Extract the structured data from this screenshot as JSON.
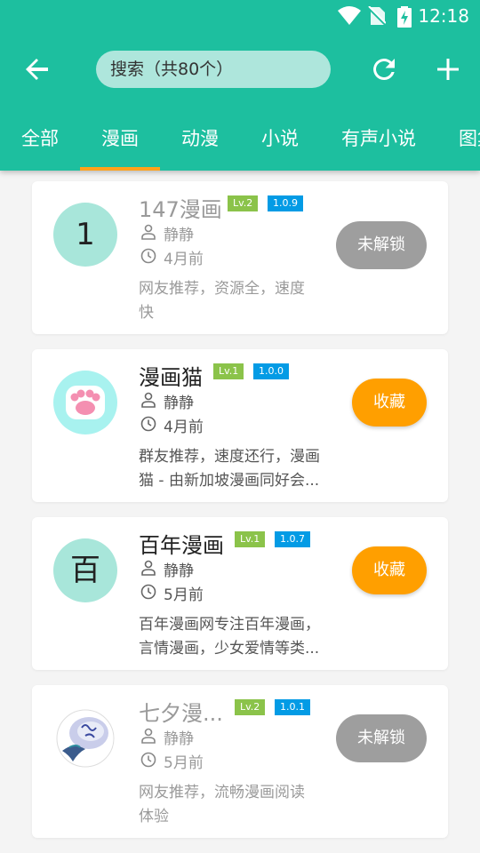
{
  "status_bar": {
    "time": "12:18"
  },
  "toolbar": {
    "search_label": "搜索（共80个）"
  },
  "tabs": [
    "全部",
    "漫画",
    "动漫",
    "小说",
    "有声小说",
    "图集"
  ],
  "active_tab": "漫画",
  "colors": {
    "primary": "#1dbf9f",
    "accent": "#ffa21a",
    "locked_button": "#9e9e9e",
    "favorite_button": "#ff9f00",
    "level_badge": "#8bc34a",
    "version_badge": "#039be5"
  },
  "cards": [
    {
      "avatar_text": "1",
      "name": "147漫画",
      "level": "Lv.2",
      "version": "1.0.9",
      "author": "静静",
      "time": "4月前",
      "desc_lines": [
        "网友推荐，资源全，速度",
        "快"
      ],
      "button": "未解锁",
      "locked": true
    },
    {
      "avatar_text": "",
      "avatar_icon": "cat-paw-icon",
      "name": "漫画猫",
      "level": "Lv.1",
      "version": "1.0.0",
      "author": "静静",
      "time": "4月前",
      "desc_lines": [
        "群友推荐，速度还行，漫画",
        "猫 - 由新加坡漫画同好会..."
      ],
      "button": "收藏",
      "locked": false
    },
    {
      "avatar_text": "百",
      "name": "百年漫画",
      "level": "Lv.1",
      "version": "1.0.7",
      "author": "静静",
      "time": "5月前",
      "desc_lines": [
        "百年漫画网专注百年漫画，",
        "言情漫画，少女爱情等类..."
      ],
      "button": "收藏",
      "locked": false
    },
    {
      "avatar_text": "",
      "avatar_icon": "qixi-logo-icon",
      "name": "七夕漫...",
      "level": "Lv.2",
      "version": "1.0.1",
      "author": "静静",
      "time": "5月前",
      "desc_lines": [
        "网友推荐，流畅漫画阅读",
        "体验"
      ],
      "button": "未解锁",
      "locked": true
    }
  ]
}
